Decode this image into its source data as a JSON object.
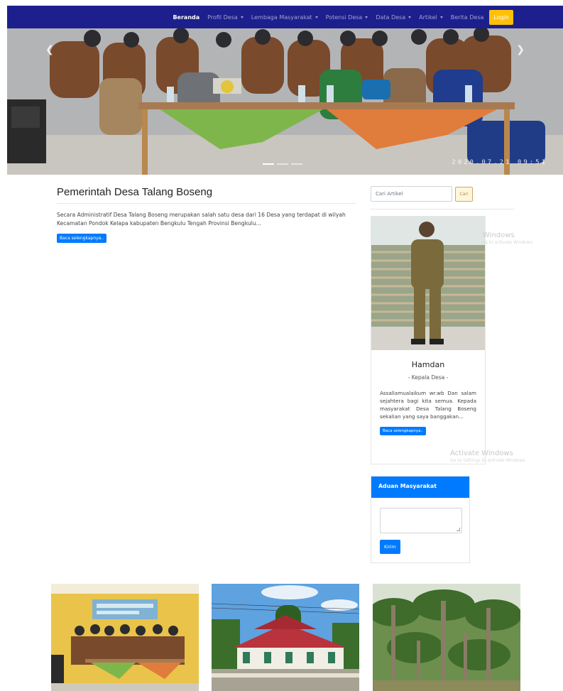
{
  "navbar": {
    "items": [
      {
        "label": "Beranda",
        "active": true,
        "dropdown": false
      },
      {
        "label": "Profil Desa",
        "active": false,
        "dropdown": true
      },
      {
        "label": "Lembaga Masyarakat",
        "active": false,
        "dropdown": true
      },
      {
        "label": "Potensi Desa",
        "active": false,
        "dropdown": true
      },
      {
        "label": "Data Desa",
        "active": false,
        "dropdown": true
      },
      {
        "label": "Artikel",
        "active": false,
        "dropdown": true
      },
      {
        "label": "Berita Desa",
        "active": false,
        "dropdown": false
      }
    ],
    "login_label": "Login"
  },
  "hero": {
    "prev_icon": "chevron-left-icon",
    "next_icon": "chevron-right-icon",
    "slide_count": 3,
    "active_slide": 1,
    "timestamp": "2020.07.21 09:51"
  },
  "article": {
    "title": "Pemerintah Desa Talang Boseng",
    "text": "Secara Administratif Desa Talang Boseng merupakan salah satu desa dari 16 Desa yang terdapat di wilyah Kecamatan Pondok Kelapa kabupaten Bengkulu Tengah Provinsi Bengkulu...",
    "read_more": "Baca selengkapnya.."
  },
  "search": {
    "placeholder": "Cari Artikel",
    "button_label": "Cari"
  },
  "profile": {
    "name": "Hamdan",
    "role": "- Kepala Desa -",
    "text": "Assallamualaikum wr.wb Dan salam sejahtera bagi kita semua. Kepada masyarakat Desa Talang Boseng sekalian yang saya banggakan...",
    "read_more": "Baca selengkapnya.."
  },
  "watermark": {
    "title": "Activate Windows",
    "subtitle": "Go to Settings to activate Windows.",
    "partial_title": "Windows",
    "partial_subtitle": "gs to activate Windows."
  },
  "aduan": {
    "title": "Aduan Masyarakat",
    "submit_label": "Kirim"
  },
  "colors": {
    "navbar": "#1c1f8c",
    "primary": "#007bff",
    "login": "#ffc107"
  }
}
